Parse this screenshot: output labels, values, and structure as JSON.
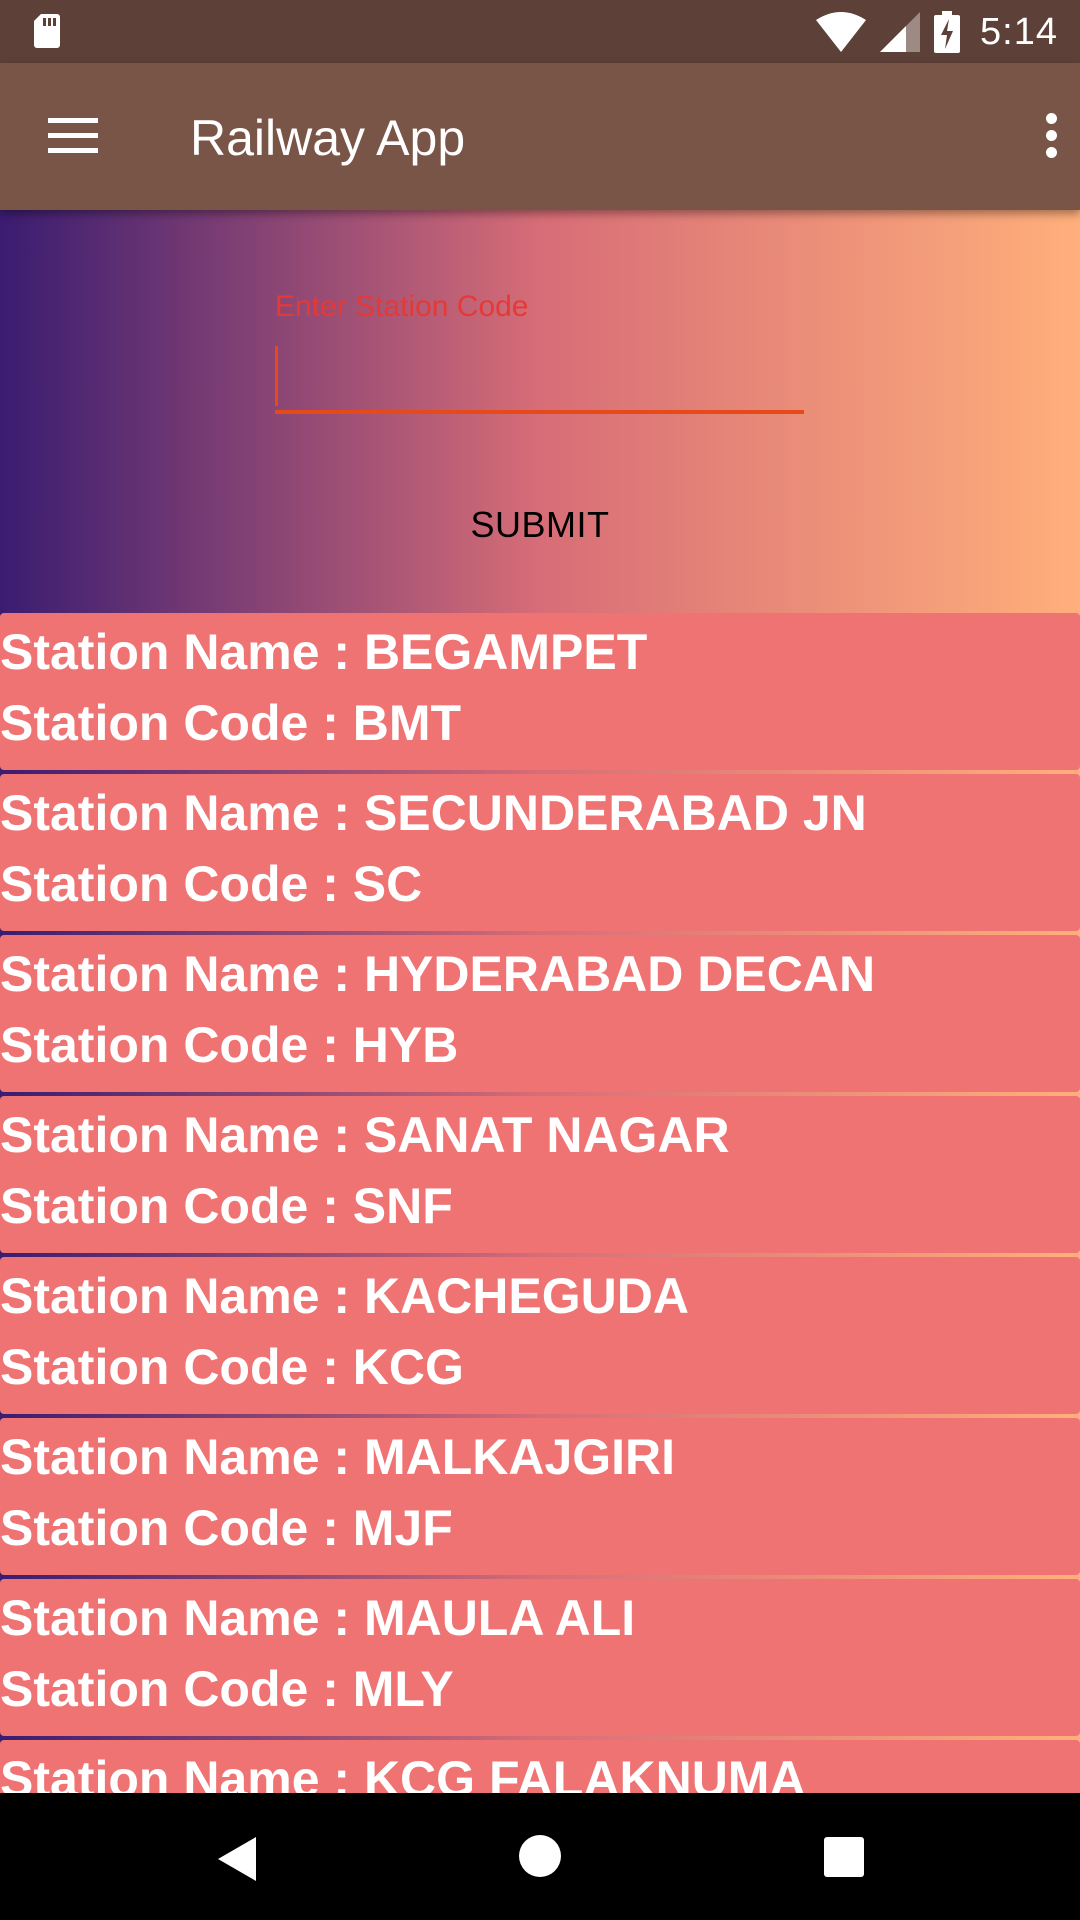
{
  "status_bar": {
    "time": "5:14"
  },
  "app_bar": {
    "title": "Railway App"
  },
  "form": {
    "input_label": "Enter Station Code",
    "input_value": "",
    "submit_label": "SUBMIT"
  },
  "stations": [
    {
      "name": "Station Name : BEGAMPET",
      "code": "Station Code : BMT"
    },
    {
      "name": "Station Name : SECUNDERABAD JN",
      "code": "Station Code : SC"
    },
    {
      "name": "Station Name : HYDERABAD DECAN",
      "code": "Station Code : HYB"
    },
    {
      "name": "Station Name : SANAT NAGAR",
      "code": "Station Code : SNF"
    },
    {
      "name": "Station Name : KACHEGUDA",
      "code": "Station Code : KCG"
    },
    {
      "name": "Station Name : MALKAJGIRI",
      "code": "Station Code : MJF"
    },
    {
      "name": "Station Name : MAULA ALI",
      "code": "Station Code : MLY"
    },
    {
      "name": "Station Name : KCG FALAKNUMA",
      "code": ""
    }
  ],
  "colors": {
    "status_bar": "#5d4037",
    "app_bar": "#795548",
    "card": "#ef7373",
    "accent": "#e64a19"
  }
}
